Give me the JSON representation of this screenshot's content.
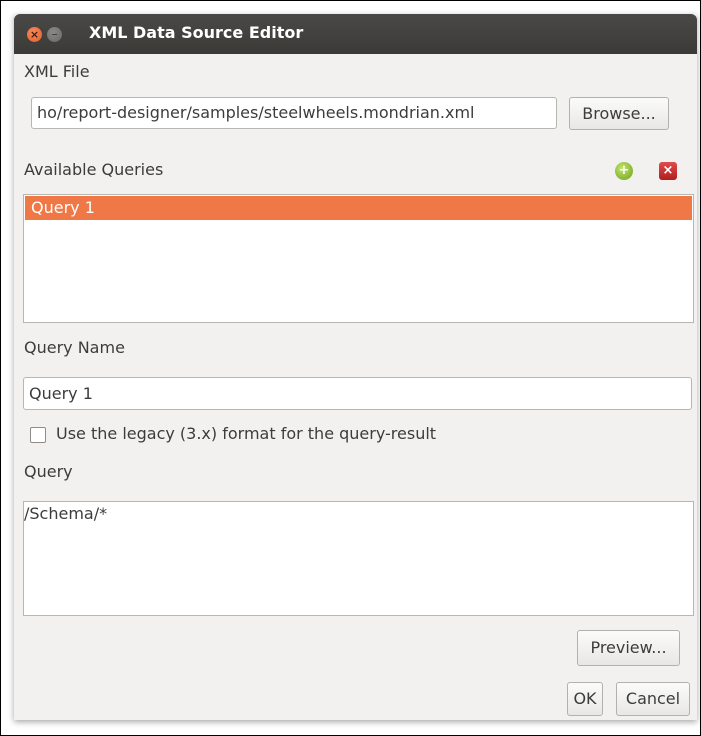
{
  "window": {
    "title": "XML Data Source Editor",
    "close_glyph": "×",
    "minimize_glyph": "−"
  },
  "xml_file": {
    "label": "XML File",
    "value": "ho/report-designer/samples/steelwheels.mondrian.xml",
    "browse_label": "Browse..."
  },
  "queries": {
    "label": "Available Queries",
    "items": [
      "Query 1"
    ],
    "selected_index": 0,
    "add_icon": "add-icon",
    "remove_icon": "remove-icon"
  },
  "query_name": {
    "label": "Query Name",
    "value": "Query 1"
  },
  "legacy": {
    "label": "Use the legacy (3.x) format for the query-result",
    "checked": false
  },
  "query": {
    "label": "Query",
    "value": "/Schema/*"
  },
  "buttons": {
    "preview": "Preview...",
    "ok": "OK",
    "cancel": "Cancel"
  },
  "colors": {
    "selection": "#f07746",
    "titlebar": "#3b3a37",
    "window_bg": "#f2f1f0"
  }
}
